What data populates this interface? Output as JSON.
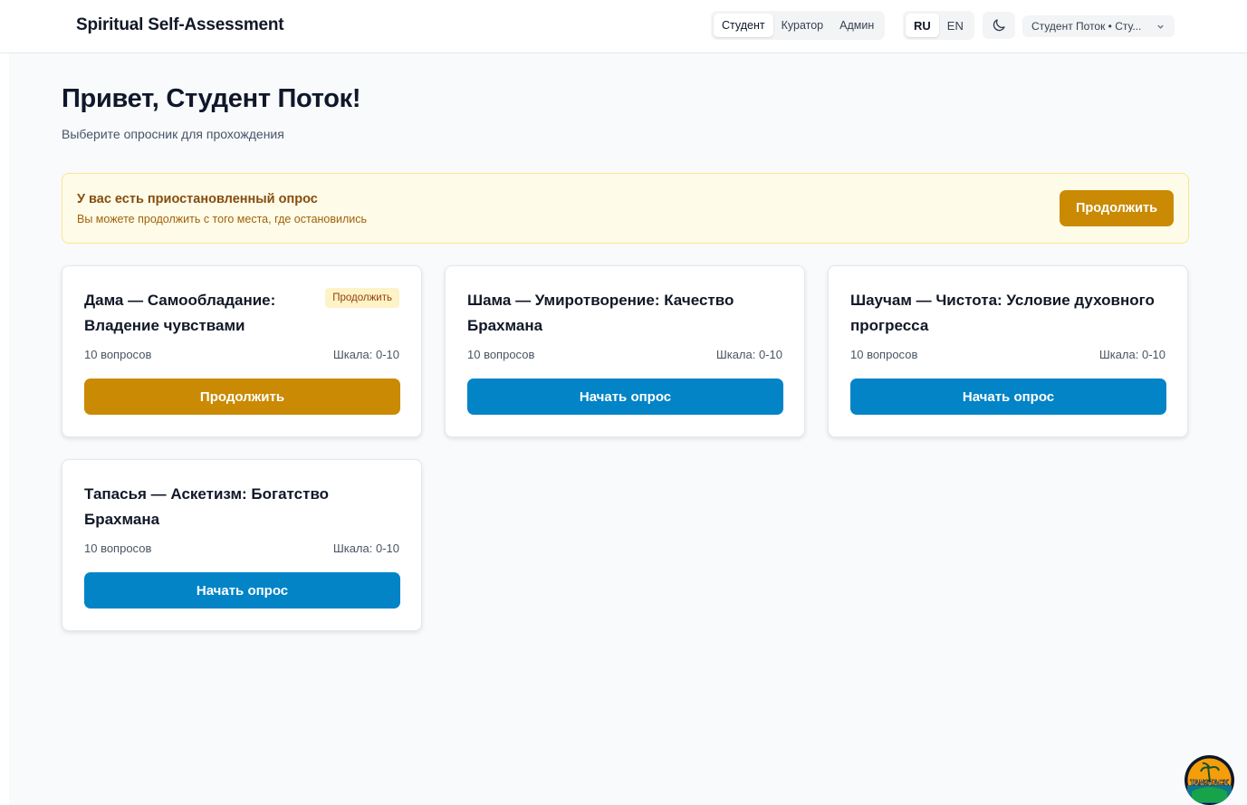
{
  "header": {
    "app_title": "Spiritual Self-Assessment",
    "roles": [
      "Студент",
      "Куратор",
      "Админ"
    ],
    "active_role": "Студент",
    "languages": [
      "RU",
      "EN"
    ],
    "active_language": "RU",
    "theme_icon": "moon-icon",
    "user_select": "Студент Поток • Сту..."
  },
  "main": {
    "greeting": "Привет, Студент Поток!",
    "subtitle": "Выберите опросник для прохождения"
  },
  "banner": {
    "title": "У вас есть приостановленный опрос",
    "text": "Вы можете продолжить с того места, где остановились",
    "button": "Продолжить"
  },
  "surveys": [
    {
      "title": "Дама — Самообладание: Владение чувствами",
      "badge": "Продолжить",
      "questions": "10 вопросов",
      "scale": "Шкала: 0-10",
      "button": "Продолжить"
    },
    {
      "title": "Шама — Умиротворение: Качество Брахмана",
      "questions": "10 вопросов",
      "scale": "Шкала: 0-10",
      "button": "Начать опрос"
    },
    {
      "title": "Шаучам — Чистота: Условие духовного прогресса",
      "questions": "10 вопросов",
      "scale": "Шкала: 0-10",
      "button": "Начать опрос"
    },
    {
      "title": "Тапасья — Аскетизм: Богатство Брахмана",
      "questions": "10 вопросов",
      "scale": "Шкала: 0-10",
      "button": "Начать опрос"
    }
  ],
  "devtools": {
    "label": "TANSTACK"
  },
  "colors": {
    "accent_blue": "#0284c7",
    "accent_gold": "#ca8a04",
    "banner_bg": "#fefbe8"
  }
}
